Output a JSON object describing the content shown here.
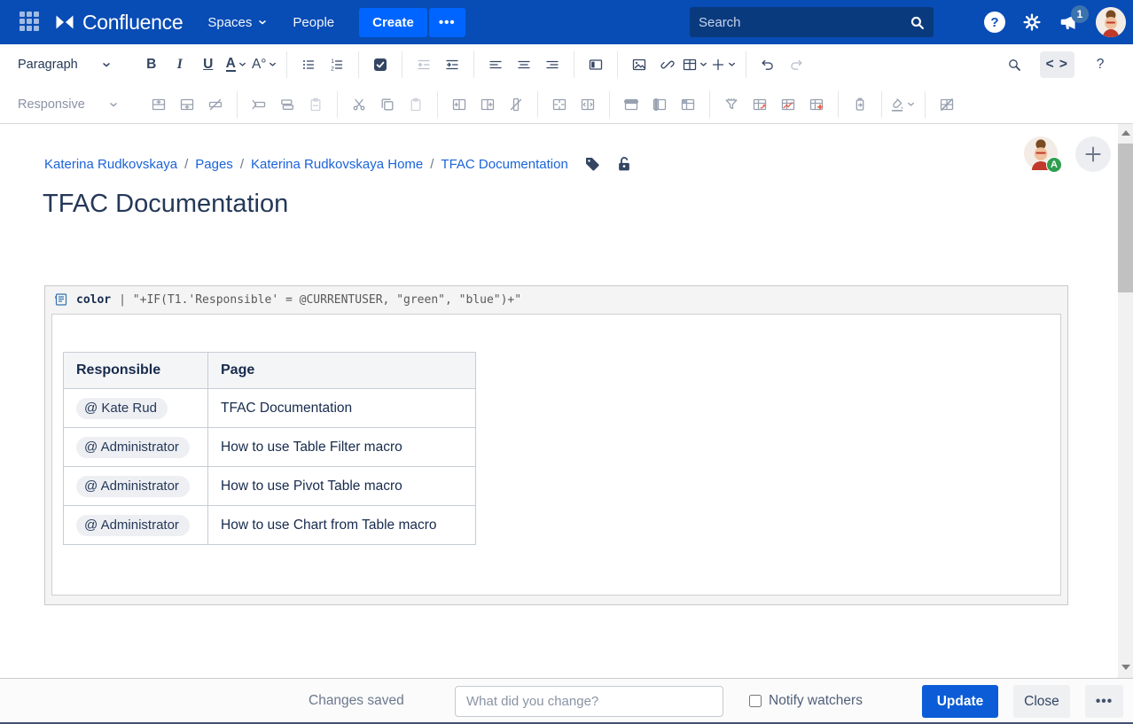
{
  "nav": {
    "product": "Confluence",
    "menu": [
      {
        "label": "Spaces",
        "dropdown": true
      },
      {
        "label": "People",
        "dropdown": false
      }
    ],
    "create_label": "Create",
    "more_label": "•••",
    "search_placeholder": "Search",
    "help_glyph": "?",
    "notification_count": "1"
  },
  "toolbar_row1": {
    "style_label": "Paragraph",
    "groups": [
      [
        {
          "name": "bold",
          "text": "B",
          "cls": "b"
        },
        {
          "name": "italic",
          "text": "I",
          "cls": "i"
        },
        {
          "name": "underline",
          "text": "U",
          "cls": "u"
        },
        {
          "name": "text-color",
          "text": "A",
          "cls": "a",
          "dropdown": true
        },
        {
          "name": "formatting-more",
          "text": "A°",
          "dropdown": true
        }
      ],
      [
        {
          "name": "bullet-list"
        },
        {
          "name": "numbered-list"
        }
      ],
      [
        {
          "name": "task-list"
        }
      ],
      [
        {
          "name": "outdent",
          "disabled": true
        },
        {
          "name": "indent"
        }
      ],
      [
        {
          "name": "align-left"
        },
        {
          "name": "align-center"
        },
        {
          "name": "align-right"
        }
      ],
      [
        {
          "name": "page-layout"
        }
      ],
      [
        {
          "name": "insert-image"
        },
        {
          "name": "insert-link"
        },
        {
          "name": "insert-table",
          "dropdown": true
        },
        {
          "name": "insert-more",
          "dropdown": true
        }
      ],
      [
        {
          "name": "undo"
        },
        {
          "name": "redo",
          "disabled": true
        }
      ]
    ],
    "right": [
      {
        "name": "find"
      },
      {
        "name": "source-editor",
        "text": "< >",
        "boxed": true
      },
      {
        "name": "editor-help",
        "text": "?"
      }
    ]
  },
  "toolbar_row2": {
    "layout_label": "Responsive",
    "groups": [
      [
        {
          "name": "insert-row-above"
        },
        {
          "name": "insert-row-below"
        },
        {
          "name": "remove-row"
        }
      ],
      [
        {
          "name": "cut-row"
        },
        {
          "name": "copy-row"
        },
        {
          "name": "paste-row",
          "disabled": true
        }
      ],
      [
        {
          "name": "cut"
        },
        {
          "name": "copy"
        },
        {
          "name": "paste",
          "disabled": true
        }
      ],
      [
        {
          "name": "insert-column-before"
        },
        {
          "name": "insert-column-after"
        },
        {
          "name": "remove-column"
        }
      ],
      [
        {
          "name": "merge-cells"
        },
        {
          "name": "split-cells"
        }
      ],
      [
        {
          "name": "heading-row"
        },
        {
          "name": "heading-column"
        },
        {
          "name": "heading-cell"
        }
      ],
      [
        {
          "name": "table-filter"
        },
        {
          "name": "pivot-table"
        },
        {
          "name": "chart-from-table"
        },
        {
          "name": "table-transformer"
        }
      ],
      [
        {
          "name": "table-excerpt"
        }
      ],
      [
        {
          "name": "cell-fill-color",
          "dropdown": true
        }
      ],
      [
        {
          "name": "remove-table"
        }
      ]
    ]
  },
  "breadcrumb": {
    "items": [
      "Katerina Rudkovskaya",
      "Pages",
      "Katerina Rudkovskaya Home",
      "TFAC Documentation"
    ],
    "separator": "/"
  },
  "page": {
    "title": "TFAC Documentation",
    "presence_badge": "A"
  },
  "macro": {
    "name": "color",
    "params": "| \"+IF(T1.'Responsible' = @CURRENTUSER, \"green\", \"blue\")+\""
  },
  "table": {
    "headers": [
      "Responsible",
      "Page"
    ],
    "rows": [
      {
        "responsible": "@ Kate Rud",
        "page": "TFAC Documentation"
      },
      {
        "responsible": "@ Administrator",
        "page": "How to use Table Filter macro"
      },
      {
        "responsible": "@ Administrator",
        "page": "How to use Pivot Table macro"
      },
      {
        "responsible": "@ Administrator",
        "page": "How to use Chart from Table macro"
      }
    ]
  },
  "footer": {
    "status": "Changes saved",
    "comment_placeholder": "What did you change?",
    "notify_label": "Notify watchers",
    "update_label": "Update",
    "close_label": "Close",
    "more_label": "•••"
  },
  "colors": {
    "nav_bg": "#084CB5",
    "nav_search_bg": "#0A3A7E",
    "button_blue": "#0065FF",
    "badge_bg": "#3B73AF",
    "link": "#1B63D8",
    "icon": "#344563",
    "icon_muted": "#97A0AF",
    "icon_disabled": "#B9C0CC",
    "icon_accent": "#E8604F",
    "title": "#253858",
    "text": "#172B4D",
    "table_border": "#C7CCD4",
    "th_bg": "#F4F5F7",
    "pill_bg": "#EDEFF3",
    "macro_bg": "#F4F4F4",
    "macro_border": "#C9C9C9",
    "macro_name": "#172B4D",
    "macro_code": "#595959",
    "macro_icon": "#3572B0",
    "presence_green": "#2F9E4F",
    "update_bg": "#0B5CD6",
    "status": "#6B778C",
    "scroll_track": "#F1F1F1",
    "scroll_thumb": "#C1C1C1"
  }
}
